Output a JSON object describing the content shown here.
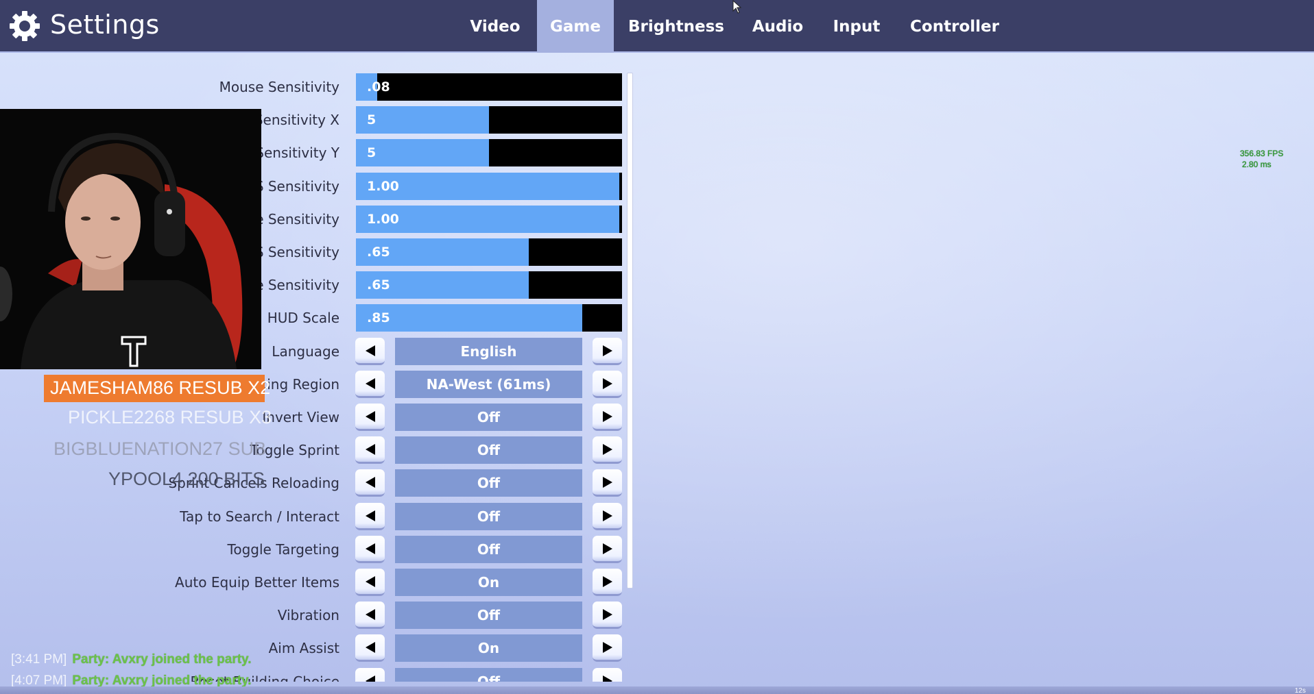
{
  "header": {
    "title": "Settings",
    "tabs": [
      {
        "label": "Video",
        "active": false
      },
      {
        "label": "Game",
        "active": true
      },
      {
        "label": "Brightness",
        "active": false
      },
      {
        "label": "Audio",
        "active": false
      },
      {
        "label": "Input",
        "active": false
      },
      {
        "label": "Controller",
        "active": false
      }
    ]
  },
  "sliders": [
    {
      "label": "Mouse Sensitivity",
      "value": ".08",
      "fill_fraction": 0.08
    },
    {
      "label": "Sensitivity X",
      "value": "5",
      "fill_fraction": 0.5
    },
    {
      "label": "Sensitivity Y",
      "value": "5",
      "fill_fraction": 0.5
    },
    {
      "label": "S Sensitivity",
      "value": "1.00",
      "fill_fraction": 1.0
    },
    {
      "label": "e Sensitivity",
      "value": "1.00",
      "fill_fraction": 1.0
    },
    {
      "label": "S Sensitivity",
      "value": ".65",
      "fill_fraction": 0.65
    },
    {
      "label": "e Sensitivity",
      "value": ".65",
      "fill_fraction": 0.65
    },
    {
      "label": "HUD Scale",
      "value": ".85",
      "fill_fraction": 0.85
    }
  ],
  "selectors": [
    {
      "label": "Language",
      "value": "English"
    },
    {
      "label": "king Region",
      "value": "NA-West (61ms)"
    },
    {
      "label": "Invert View",
      "value": "Off"
    },
    {
      "label": "Toggle Sprint",
      "value": "Off"
    },
    {
      "label": "Sprint Cancels Reloading",
      "value": "Off"
    },
    {
      "label": "Tap to Search / Interact",
      "value": "Off"
    },
    {
      "label": "Toggle Targeting",
      "value": "Off"
    },
    {
      "label": "Auto Equip Better Items",
      "value": "On"
    },
    {
      "label": "Vibration",
      "value": "Off"
    },
    {
      "label": "Aim Assist",
      "value": "On"
    },
    {
      "label": "Reset Building Choice",
      "value": "Off"
    }
  ],
  "overlay": {
    "alerts": [
      "JAMESHAM86  RESUB X2",
      "PICKLE2268  RESUB X3",
      "BIGBLUENATION27  SUB",
      "YPOOL4  200 BITS"
    ],
    "fps": "356.83 FPS",
    "frame_time": "2.80 ms",
    "chat": [
      {
        "time": "[3:41 PM]",
        "message": "Party: Avxry joined the party."
      },
      {
        "time": "[4:07 PM]",
        "message": "Party: Avxry joined the party."
      }
    ],
    "timer": "12s"
  },
  "colors": {
    "header_bg": "#3b3f66",
    "active_tab": "#a4b0df",
    "slider_fill": "#62a6f6",
    "slider_track": "#000000",
    "value_box": "#8199d3",
    "alert_bg": "#ee7b2f",
    "fps_text": "#2a9a2a"
  }
}
